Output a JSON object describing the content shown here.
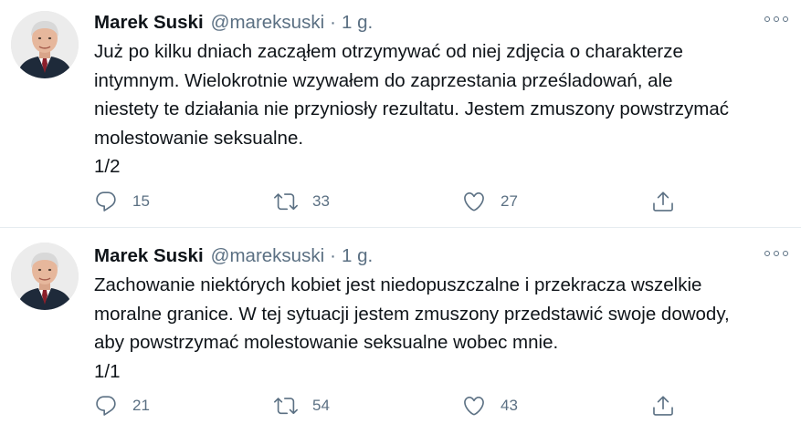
{
  "tweets": [
    {
      "author": {
        "name": "Marek Suski",
        "handle": "@mareksuski"
      },
      "separator": "·",
      "time": "1 g.",
      "body": [
        "Już po kilku dniach zacząłem otrzymywać od niej zdjęcia o charakterze",
        "intymnym. Wielokrotnie wzywałem do zaprzestania prześladowań, ale",
        "niestety te działania nie przyniosły rezultatu. Jestem zmuszony powstrzymać",
        "molestowanie seksualne.",
        "1/2"
      ],
      "replies": "15",
      "retweets": "33",
      "likes": "27"
    },
    {
      "author": {
        "name": "Marek Suski",
        "handle": "@mareksuski"
      },
      "separator": "·",
      "time": "1 g.",
      "body": [
        "Zachowanie niektórych kobiet jest niedopuszczalne i przekracza wszelkie",
        "moralne granice. W tej sytuacji jestem zmuszony przedstawić swoje dowody,",
        "aby powstrzymać molestowanie seksualne wobec mnie.",
        "1/1"
      ],
      "replies": "21",
      "retweets": "54",
      "likes": "43"
    }
  ],
  "icons": {
    "reply": "reply-icon",
    "retweet": "retweet-icon",
    "like": "heart-icon",
    "share": "share-icon",
    "more": "more-options-icon"
  },
  "colors": {
    "text": "#0f1419",
    "secondary": "#5b7083",
    "divider": "#e6ecf0"
  }
}
